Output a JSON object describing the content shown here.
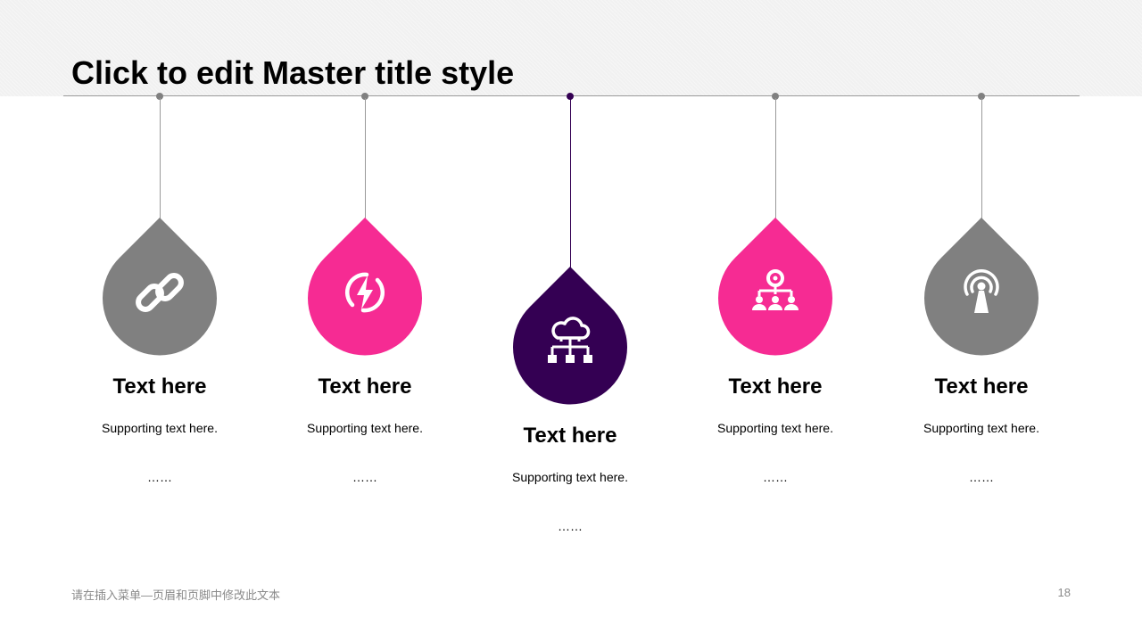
{
  "slide": {
    "title": "Click to edit Master title style",
    "footer_text": "请在插入菜单—页眉和页脚中修改此文本",
    "page_number": "18"
  },
  "colors": {
    "gray": "#808080",
    "pink": "#f62b93",
    "purple": "#340053",
    "line_gray": "#9a9a9a"
  },
  "items": [
    {
      "heading": "Text here",
      "support": "Supporting  text here.",
      "ellipsis": "……",
      "icon": "link-icon",
      "color": "gray"
    },
    {
      "heading": "Text here",
      "support": "Supporting  text here.",
      "ellipsis": "……",
      "icon": "lightning-icon",
      "color": "pink"
    },
    {
      "heading": "Text here",
      "support": "Supporting  text here.",
      "ellipsis": "……",
      "icon": "cloud-network-icon",
      "color": "purple"
    },
    {
      "heading": "Text here",
      "support": "Supporting  text here.",
      "ellipsis": "……",
      "icon": "team-hierarchy-icon",
      "color": "pink"
    },
    {
      "heading": "Text here",
      "support": "Supporting  text here.",
      "ellipsis": "……",
      "icon": "broadcast-tower-icon",
      "color": "gray"
    }
  ]
}
